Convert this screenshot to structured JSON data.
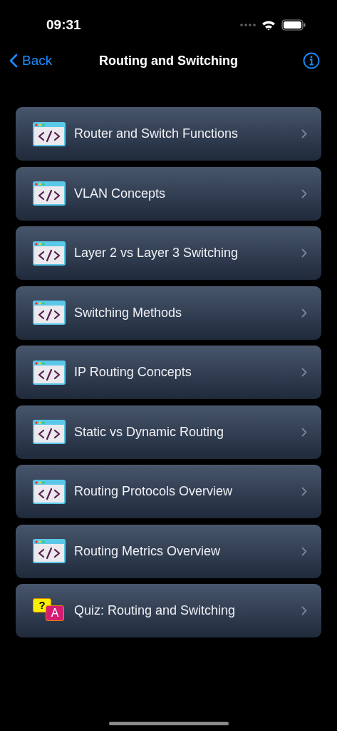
{
  "status_bar": {
    "time": "09:31"
  },
  "nav": {
    "back": "Back",
    "title": "Routing and Switching"
  },
  "items": [
    {
      "kind": "lesson",
      "label": "Router and Switch Functions"
    },
    {
      "kind": "lesson",
      "label": "VLAN Concepts"
    },
    {
      "kind": "lesson",
      "label": "Layer 2 vs Layer 3 Switching"
    },
    {
      "kind": "lesson",
      "label": "Switching Methods"
    },
    {
      "kind": "lesson",
      "label": "IP Routing Concepts"
    },
    {
      "kind": "lesson",
      "label": "Static vs Dynamic Routing"
    },
    {
      "kind": "lesson",
      "label": "Routing Protocols Overview"
    },
    {
      "kind": "lesson",
      "label": "Routing Metrics Overview"
    },
    {
      "kind": "quiz",
      "label": "Quiz: Routing and Switching",
      "marks": [
        "?",
        "A"
      ]
    }
  ]
}
